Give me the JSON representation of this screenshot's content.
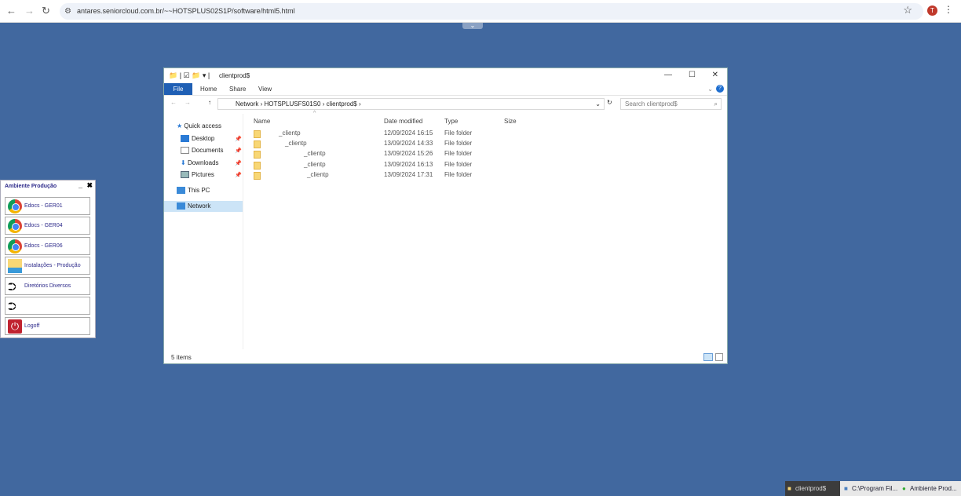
{
  "browser": {
    "url": "antares.seniorcloud.com.br/~~HOTSPLUS02S1P/software/html5.html",
    "avatar": "T"
  },
  "explorer": {
    "title": "clientprod$",
    "ribbon_tabs": [
      "File",
      "Home",
      "Share",
      "View"
    ],
    "path": [
      "Network",
      "HOTSPLUSFS01S0",
      "clientprod$"
    ],
    "search_placeholder": "Search clientprod$",
    "nav": [
      {
        "label": "Quick access"
      },
      {
        "label": "Desktop"
      },
      {
        "label": "Documents"
      },
      {
        "label": "Downloads"
      },
      {
        "label": "Pictures"
      },
      {
        "label": "This PC"
      },
      {
        "label": "Network"
      }
    ],
    "columns": [
      "Name",
      "Date modified",
      "Type",
      "Size"
    ],
    "rows": [
      {
        "name": "_clientp",
        "date": "12/09/2024 16:15",
        "type": "File folder"
      },
      {
        "name": "_clientp",
        "date": "13/09/2024 14:33",
        "type": "File folder"
      },
      {
        "name": "_clientp",
        "date": "13/09/2024 15:26",
        "type": "File folder"
      },
      {
        "name": "_clientp",
        "date": "13/09/2024 16:13",
        "type": "File folder"
      },
      {
        "name": "_clientp",
        "date": "13/09/2024 17:31",
        "type": "File folder"
      }
    ],
    "status": "5 items"
  },
  "panel": {
    "title": "Ambiente Produção",
    "buttons": [
      "Edocs - GER01",
      "Edocs - GER04",
      "Edocs - GER06",
      "Instalações - Produção",
      "Diretórios Diversos",
      "",
      "Logoff"
    ]
  },
  "taskbar": [
    "clientprod$",
    "C:\\Program Fil...",
    "Ambiente Prod..."
  ]
}
